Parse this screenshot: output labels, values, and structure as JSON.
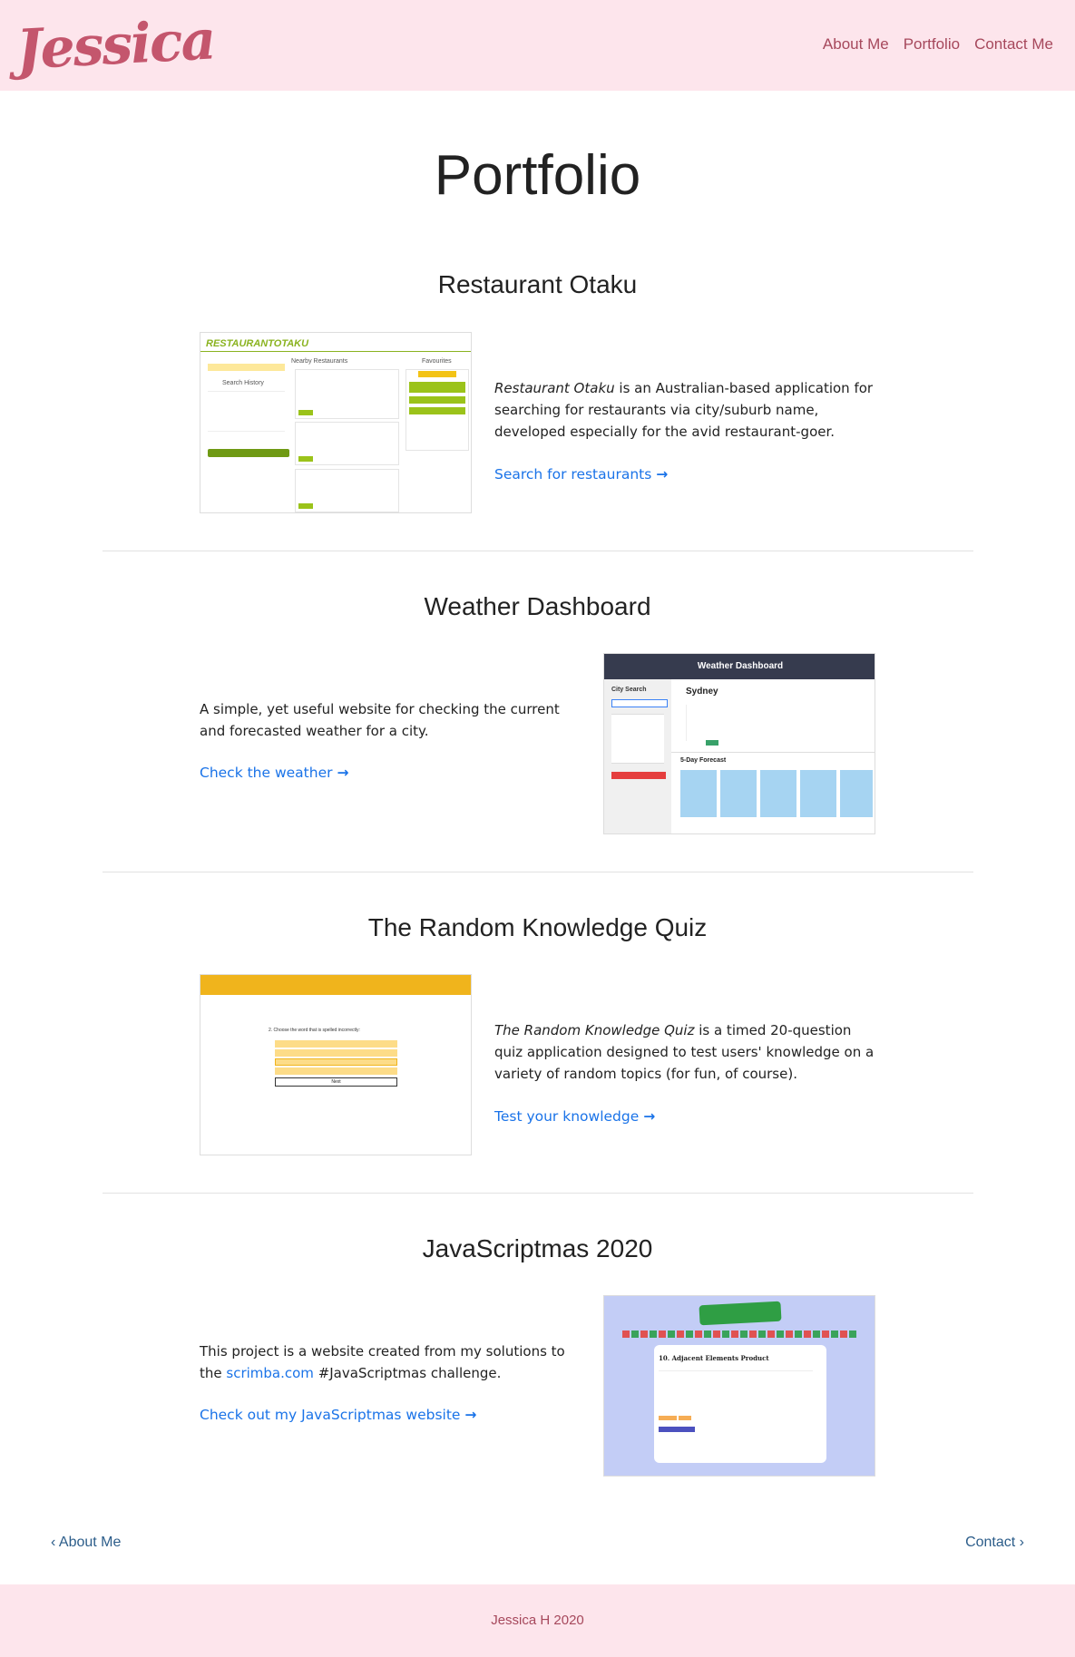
{
  "brand": {
    "logo_text": "Jessica"
  },
  "nav": {
    "about": "About Me",
    "portfolio": "Portfolio",
    "contact": "Contact Me"
  },
  "page": {
    "title": "Portfolio"
  },
  "projects": [
    {
      "title": "Restaurant Otaku",
      "desc_em": "Restaurant Otaku",
      "desc_rest": " is an Australian-based application for searching for restaurants via city/suburb name, developed especially for the avid restaurant-goer.",
      "link": "Search for restaurants",
      "shot": {
        "logo": "RESTAURANTOTAKU",
        "heading": "Nearby Restaurants",
        "history": "Search History",
        "favs": "Favourites"
      }
    },
    {
      "title": "Weather Dashboard",
      "desc": "A simple, yet useful website for checking the current and forecasted weather for a city.",
      "link": "Check the weather",
      "shot": {
        "header": "Weather Dashboard",
        "city_search": "City Search",
        "city": "Sydney",
        "forecast": "5-Day Forecast"
      }
    },
    {
      "title": "The Random Knowledge Quiz",
      "desc_em": "The Random Knowledge Quiz",
      "desc_rest": " is a timed 20-question quiz application designed to test users' knowledge on a variety of random topics (for fun, of course).",
      "link": "Test your knowledge",
      "shot": {
        "question": "2. Choose the word that is spelled incorrectly:",
        "next": "Next"
      }
    },
    {
      "title": "JavaScriptmas 2020",
      "desc_before": "This project is a website created from my solutions to the ",
      "desc_link": "scrimba.com",
      "desc_after": " #JavaScriptmas challenge.",
      "link": "Check out my JavaScriptmas website",
      "shot": {
        "heading": "10. Adjacent Elements Product"
      }
    }
  ],
  "pager": {
    "prev": "About Me",
    "next": "Contact"
  },
  "footer": {
    "text": "Jessica H 2020"
  },
  "colors": {
    "nav_bg": "#fde5ec",
    "brand": "#c4566d",
    "link": "#1a73e8"
  }
}
